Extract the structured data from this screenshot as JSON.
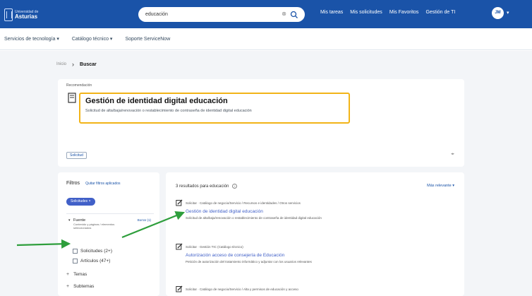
{
  "header": {
    "logo_line1": "Universidad de",
    "logo_line2": "Asturias",
    "search_value": "educación",
    "nav": [
      "Mis tareas",
      "Mis solicitudes",
      "Mis Favoritos",
      "Gestión de TI"
    ],
    "avatar_initials": "JM"
  },
  "subnav": {
    "items": [
      "Servicios de tecnología ▾",
      "Catálogo técnico ▾",
      "Soporte ServiceNow"
    ]
  },
  "breadcrumb": {
    "home": "Inicio",
    "current": "Buscar"
  },
  "featured": {
    "label": "Recomendación",
    "title": "Gestión de identidad digital educación",
    "description": "Solicitud de alta/baja/renovación o restablecimiento de contraseña de identidad digital educación",
    "tag": "Solicitud",
    "page": "◂▸"
  },
  "filters": {
    "title": "Filtros",
    "clear_label": "Quitar filtros aplicados",
    "active_chip": "Solicitudes ×",
    "facet": {
      "name": "Fuente",
      "link": "Borrar (1)",
      "description": "Contenido y páginas / elementos seleccionados"
    },
    "checkboxes": [
      "Solicitudes (2+)",
      "Artículos (47+)"
    ],
    "groups": [
      "Temas",
      "Subtemas"
    ]
  },
  "results": {
    "count_label": "3 resultados para educación",
    "sort_label": "Más relevante ▾",
    "items": [
      {
        "meta": "Solicitar · Catálogo de negocio/Servicio / Recursos e identidades / Otros servicios",
        "title": "Gestión de identidad digital educación",
        "description": "Solicitud de alta/baja/renovación o restablecimiento de contraseña de identidad digital educación"
      },
      {
        "meta": "Solicitar · Gestión TIC (Catálogo técnico)",
        "title": "Autorización acceso de consejería de Educación",
        "description": "Petición de autorización del tratamiento informático y adjuntar con los usuarios relevantes"
      },
      {
        "meta": "Solicitar · Catálogo de negocio/Servicio / Alta y permisos de educación y acceso"
      }
    ]
  },
  "colors": {
    "header_bg": "#1a53a8",
    "highlight_border": "#f2b418",
    "arrow": "#2e9e3c",
    "link": "#4160c8"
  }
}
